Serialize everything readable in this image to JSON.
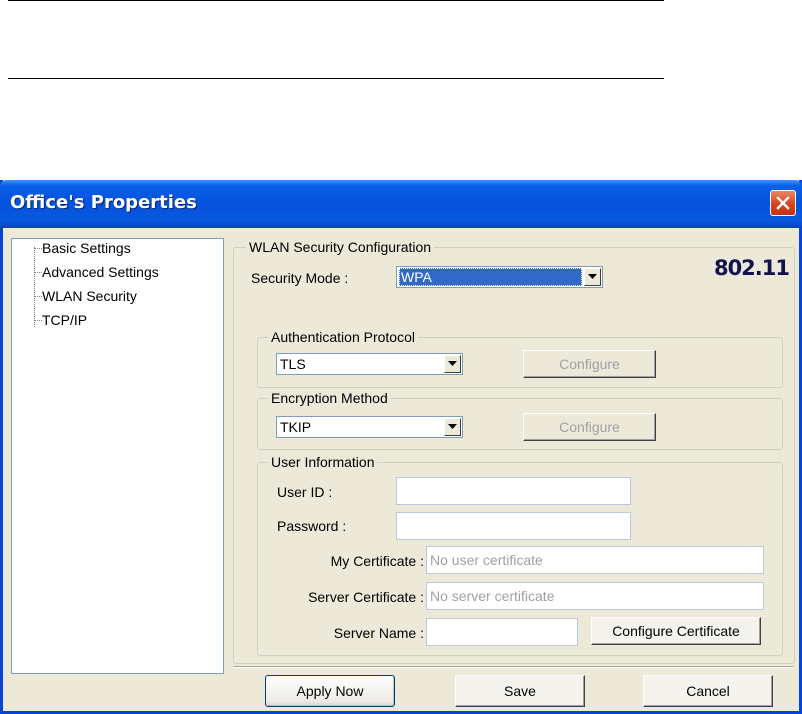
{
  "window": {
    "title": "Office's Properties",
    "brand": "802.11"
  },
  "tree": {
    "items": [
      {
        "label": "Basic Settings"
      },
      {
        "label": "Advanced Settings"
      },
      {
        "label": "WLAN Security"
      },
      {
        "label": "TCP/IP"
      }
    ]
  },
  "security": {
    "group_label": "WLAN Security Configuration",
    "mode_label": "Security Mode :",
    "mode_value": "WPA"
  },
  "auth": {
    "group_label": "Authentication Protocol",
    "value": "TLS",
    "configure_label": "Configure"
  },
  "encryption": {
    "group_label": "Encryption Method",
    "value": "TKIP",
    "configure_label": "Configure"
  },
  "user": {
    "group_label": "User Information",
    "user_id_label": "User ID :",
    "user_id_value": "",
    "password_label": "Password :",
    "password_value": "",
    "my_cert_label": "My Certificate :",
    "my_cert_placeholder": "No user certificate",
    "server_cert_label": "Server Certificate :",
    "server_cert_placeholder": "No server certificate",
    "server_name_label": "Server Name :",
    "server_name_value": "",
    "configure_cert_label": "Configure Certificate"
  },
  "footer": {
    "apply_label": "Apply Now",
    "save_label": "Save",
    "cancel_label": "Cancel"
  },
  "colors": {
    "titlebar": "#0452dc",
    "selection": "#316ac5",
    "close": "#d8421c"
  }
}
